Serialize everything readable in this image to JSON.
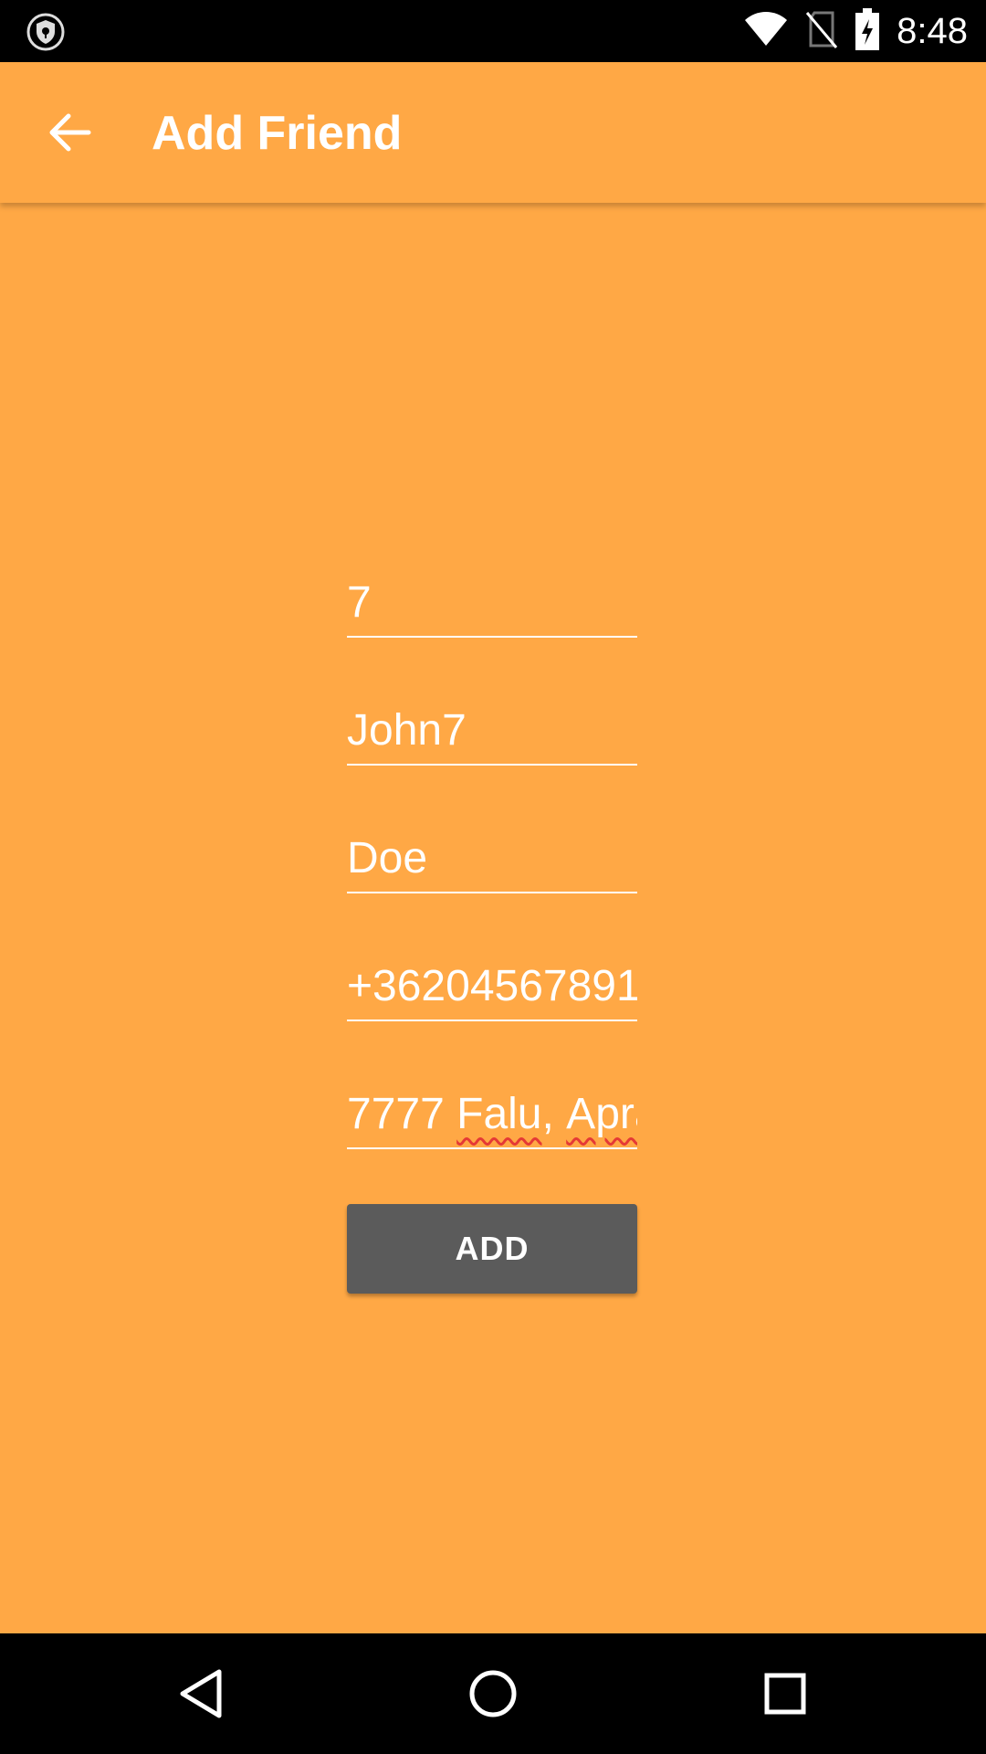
{
  "status_bar": {
    "time": "8:48",
    "icons": [
      "shield-icon",
      "wifi-icon",
      "no-sim-icon",
      "battery-charging-icon"
    ]
  },
  "app_bar": {
    "title": "Add Friend",
    "back_icon": "arrow-back-icon"
  },
  "form": {
    "fields": [
      {
        "name": "id",
        "value": "7"
      },
      {
        "name": "first_name",
        "value": "John7"
      },
      {
        "name": "last_name",
        "value": "Doe"
      },
      {
        "name": "phone",
        "value": "+36204567891"
      },
      {
        "name": "address",
        "value_parts": [
          "7777 ",
          "Falu",
          ", ",
          "Apra"
        ]
      }
    ],
    "add_button_label": "ADD"
  },
  "nav_bar": {
    "icons": [
      "back-triangle-icon",
      "home-circle-icon",
      "recents-square-icon"
    ]
  },
  "colors": {
    "background": "#FFA845",
    "button": "#5B5B5B",
    "system_bars": "#000000",
    "text": "#FFFFFF",
    "spellcheck": "#E53935"
  }
}
